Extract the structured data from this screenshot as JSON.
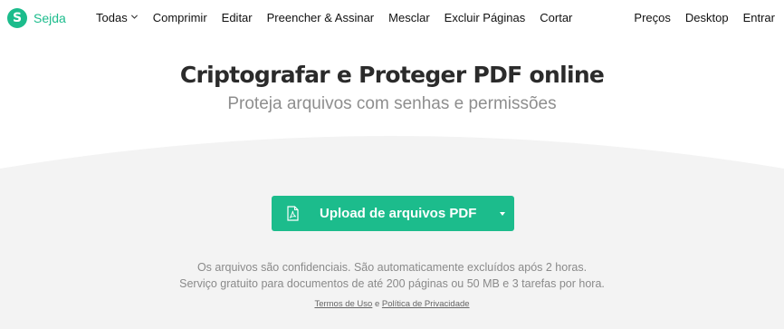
{
  "brand": {
    "logo_letter": "S",
    "name": "Sejda"
  },
  "nav": {
    "items": [
      "Todas",
      "Comprimir",
      "Editar",
      "Preencher & Assinar",
      "Mesclar",
      "Excluir Páginas",
      "Cortar"
    ],
    "right_items": [
      "Preços",
      "Desktop",
      "Entrar"
    ]
  },
  "hero": {
    "title": "Criptografar e Proteger PDF online",
    "subtitle": "Proteja arquivos com senhas e permissões"
  },
  "upload": {
    "label": "Upload de arquivos PDF",
    "icon": "pdf-file-icon",
    "dropdown_icon": "caret-down-icon"
  },
  "info": {
    "line1": "Os arquivos são confidenciais. São automaticamente excluídos após 2 horas.",
    "line2": "Serviço gratuito para documentos de até 200 páginas ou 50 MB e 3 tarefas por hora."
  },
  "legal": {
    "terms": "Termos de Uso",
    "connector": "e",
    "privacy": "Política de Privacidade"
  },
  "colors": {
    "accent": "#1cbc8c",
    "band": "#f3f3f3",
    "title": "#2b2b2b",
    "subtitle": "#8e8e8e"
  }
}
